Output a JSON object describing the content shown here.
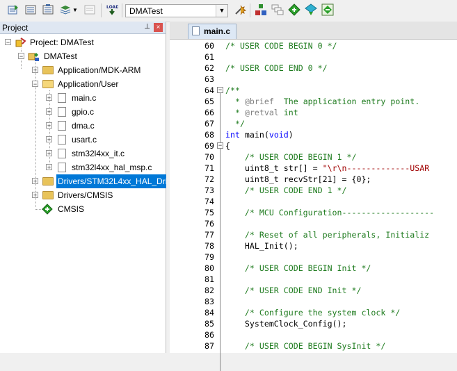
{
  "toolbar": {
    "target_name": "DMATest",
    "buttons": [
      "translate-icon",
      "build-icon",
      "rebuild-icon",
      "batch-build-icon",
      "stop-build-icon",
      "download-icon",
      "options-icon",
      "manage-components-icon",
      "select-packs-icon",
      "pack-installer-icon",
      "run-time-env-icon"
    ]
  },
  "project_panel": {
    "title": "Project",
    "pin": "⊥",
    "close": "×",
    "tree": [
      {
        "label": "Project: DMATest"
      },
      {
        "label": "DMATest"
      },
      {
        "label": "Application/MDK-ARM"
      },
      {
        "label": "Application/User"
      },
      {
        "label": "main.c"
      },
      {
        "label": "gpio.c"
      },
      {
        "label": "dma.c"
      },
      {
        "label": "usart.c"
      },
      {
        "label": "stm32l4xx_it.c"
      },
      {
        "label": "stm32l4xx_hal_msp.c"
      },
      {
        "label": "Drivers/STM32L4xx_HAL_Driv"
      },
      {
        "label": "Drivers/CMSIS"
      },
      {
        "label": "CMSIS"
      }
    ]
  },
  "editor": {
    "tab_label": "main.c",
    "lines": [
      {
        "num": "60",
        "text": "/* USER CODE BEGIN 0 */"
      },
      {
        "num": "61",
        "text": ""
      },
      {
        "num": "62",
        "text": "/* USER CODE END 0 */"
      },
      {
        "num": "63",
        "text": ""
      },
      {
        "num": "64",
        "text": "/**"
      },
      {
        "num": "65",
        "text": "  * @brief  The application entry point."
      },
      {
        "num": "66",
        "text": "  * @retval int"
      },
      {
        "num": "67",
        "text": "  */"
      },
      {
        "num": "68",
        "text": "int main(void)"
      },
      {
        "num": "69",
        "text": "{"
      },
      {
        "num": "70",
        "text": "    /* USER CODE BEGIN 1 */"
      },
      {
        "num": "71",
        "text": "    uint8_t str[] = \"\\r\\n-------------USAR"
      },
      {
        "num": "72",
        "text": "    uint8_t recvStr[21] = {0};"
      },
      {
        "num": "73",
        "text": "    /* USER CODE END 1 */"
      },
      {
        "num": "74",
        "text": ""
      },
      {
        "num": "75",
        "text": "    /* MCU Configuration-------------------"
      },
      {
        "num": "76",
        "text": ""
      },
      {
        "num": "77",
        "text": "    /* Reset of all peripherals, Initializ"
      },
      {
        "num": "78",
        "text": "    HAL_Init();"
      },
      {
        "num": "79",
        "text": ""
      },
      {
        "num": "80",
        "text": "    /* USER CODE BEGIN Init */"
      },
      {
        "num": "81",
        "text": ""
      },
      {
        "num": "82",
        "text": "    /* USER CODE END Init */"
      },
      {
        "num": "83",
        "text": ""
      },
      {
        "num": "84",
        "text": "    /* Configure the system clock */"
      },
      {
        "num": "85",
        "text": "    SystemClock_Config();"
      },
      {
        "num": "86",
        "text": ""
      },
      {
        "num": "87",
        "text": "    /* USER CODE BEGIN SysInit */"
      }
    ]
  }
}
